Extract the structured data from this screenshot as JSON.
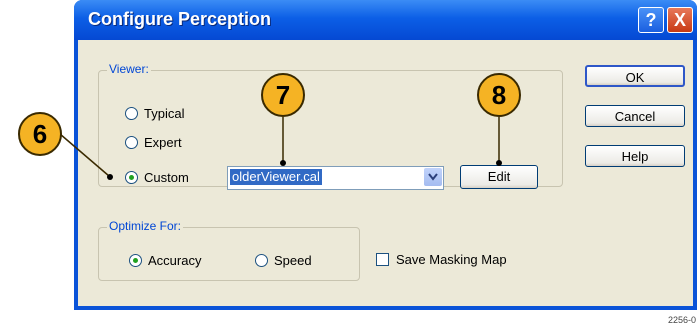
{
  "dialog": {
    "title": "Configure Perception",
    "help_button": "?",
    "close_button": "X"
  },
  "viewer_group": {
    "label": "Viewer:",
    "radios": [
      {
        "label": "Typical",
        "selected": false
      },
      {
        "label": "Expert",
        "selected": false
      },
      {
        "label": "Custom",
        "selected": true
      }
    ],
    "file_combo": {
      "value": "olderViewer.cal"
    },
    "edit_button": "Edit"
  },
  "optimize_group": {
    "label": "Optimize For:",
    "radios": [
      {
        "label": "Accuracy",
        "selected": true
      },
      {
        "label": "Speed",
        "selected": false
      }
    ]
  },
  "save_masking": {
    "label": "Save Masking Map",
    "checked": false
  },
  "buttons": {
    "ok": "OK",
    "cancel": "Cancel",
    "help": "Help"
  },
  "callouts": {
    "c6": "6",
    "c7": "7",
    "c8": "8"
  },
  "figure_number": "2256-0",
  "colors": {
    "titlebar": "#0c5fe6",
    "callout": "#f5b324",
    "selection": "#316ac5"
  }
}
